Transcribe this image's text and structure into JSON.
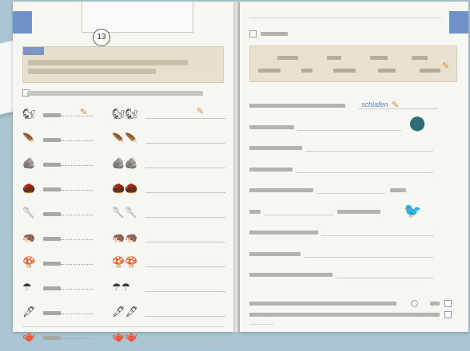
{
  "left_page": {
    "badge_number": "13",
    "rows": [
      {
        "icon_a": "🐿",
        "icon_b": "🐿🐿"
      },
      {
        "icon_a": "🪶",
        "icon_b": "🪶🪶"
      },
      {
        "icon_a": "🪨",
        "icon_b": "🪨🪨"
      },
      {
        "icon_a": "🌰",
        "icon_b": "🌰🌰"
      },
      {
        "icon_a": "🥄",
        "icon_b": "🥄🥄"
      },
      {
        "icon_a": "🦔",
        "icon_b": "🦔🦔"
      },
      {
        "icon_a": "🍄",
        "icon_b": "🍄🍄"
      },
      {
        "icon_a": "☂",
        "icon_b": "☂☂"
      },
      {
        "icon_a": "🖋",
        "icon_b": "🖋🖋"
      },
      {
        "icon_a": "🫖",
        "icon_b": "🫖🫖"
      }
    ]
  },
  "right_page": {
    "handwritten_answer": "schlafen"
  }
}
